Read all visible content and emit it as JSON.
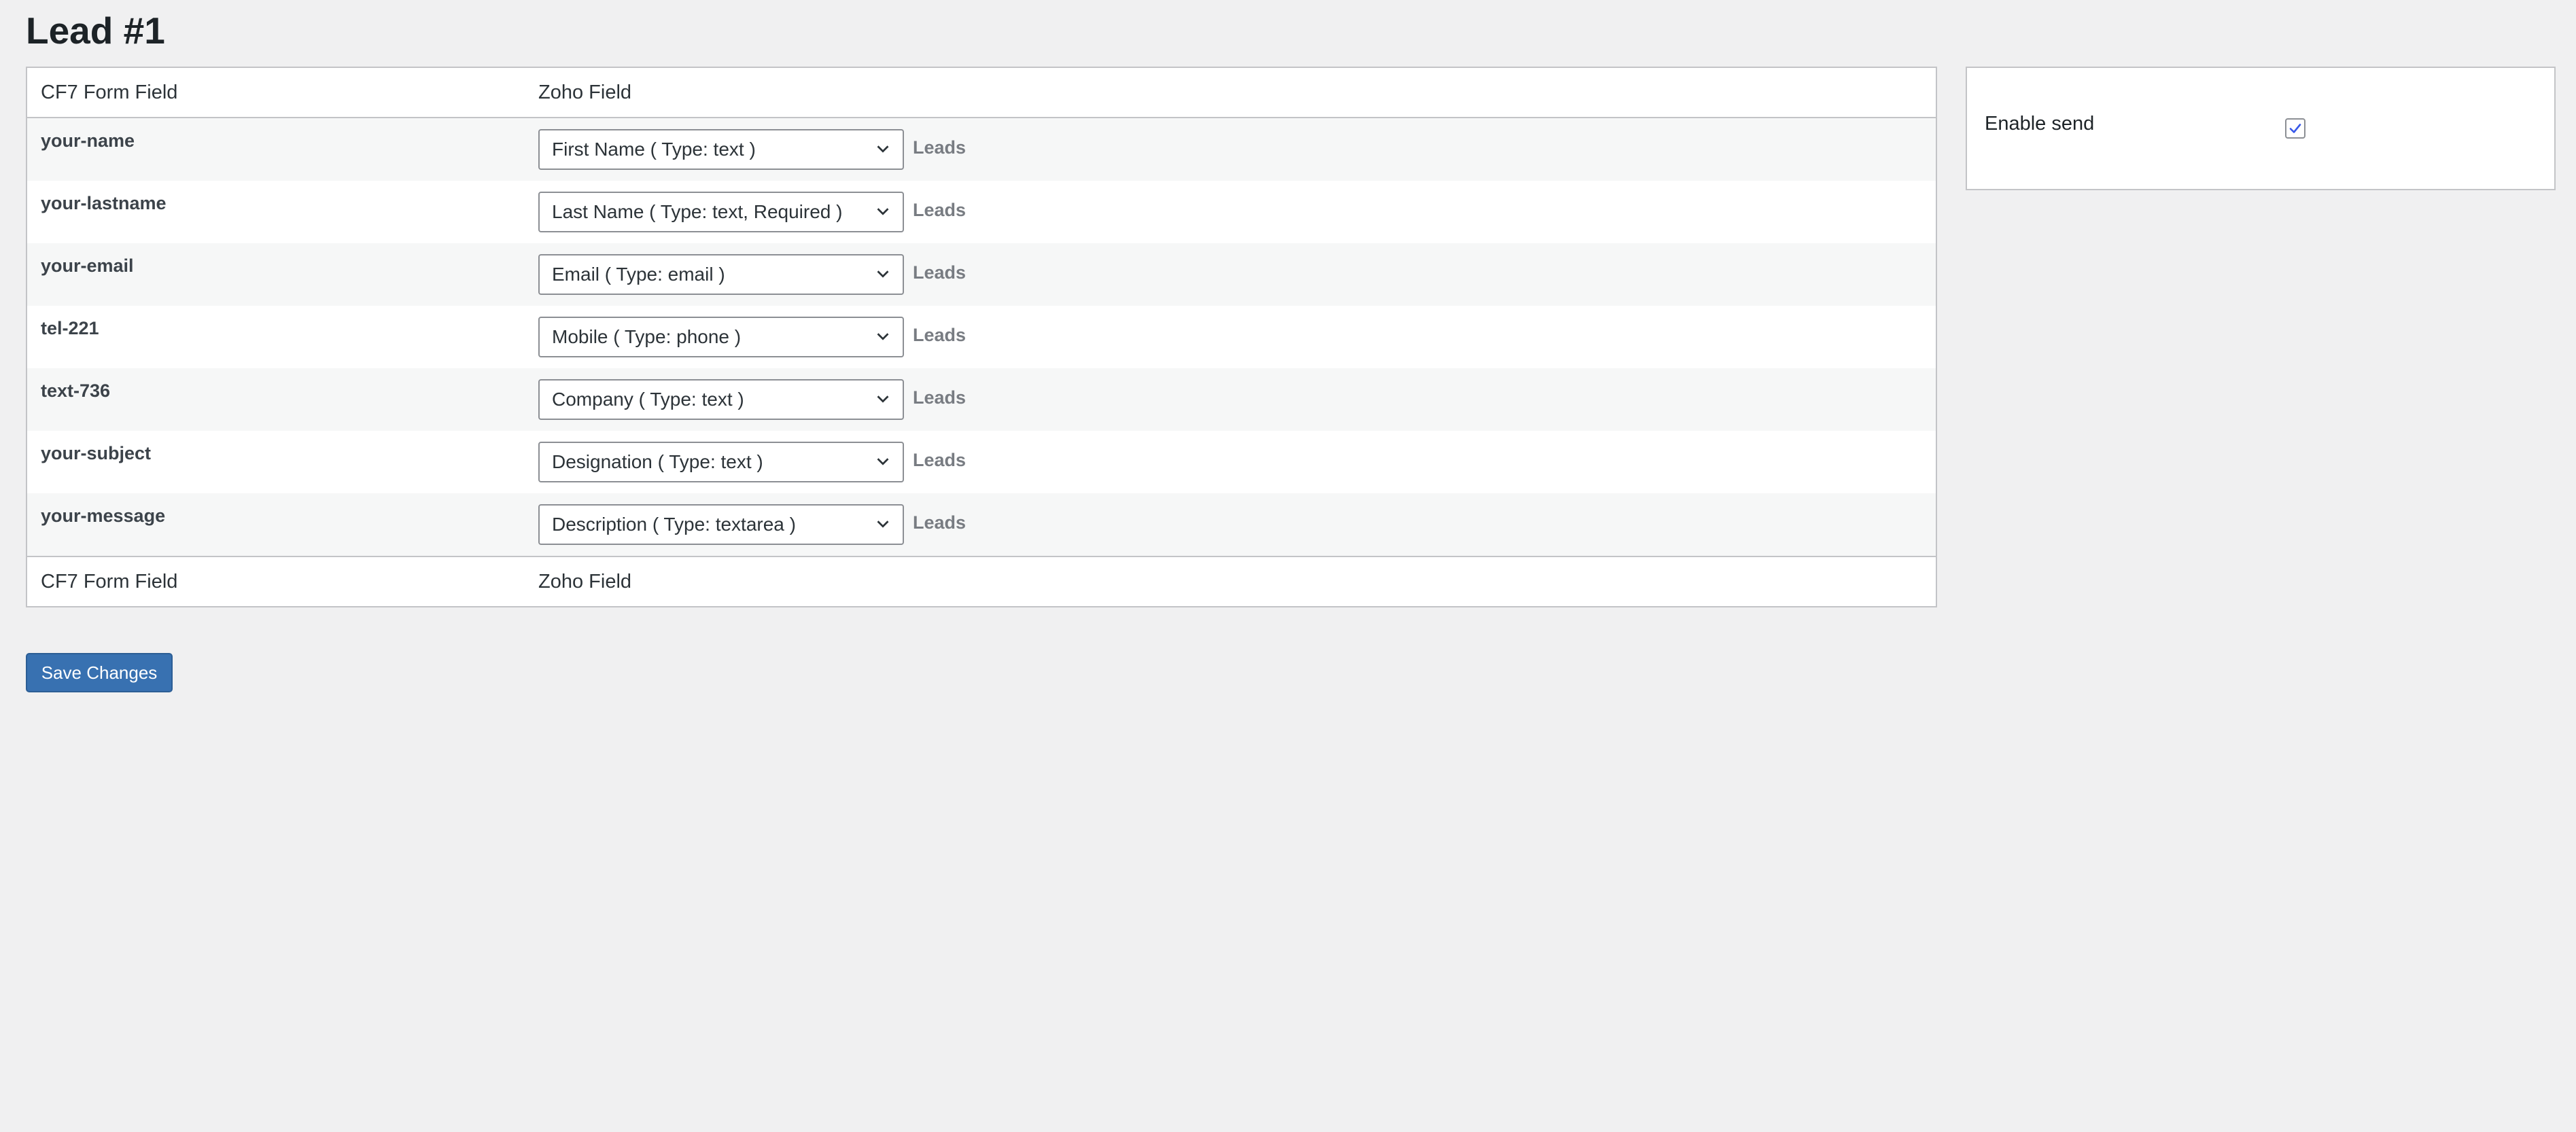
{
  "page": {
    "title": "Lead #1"
  },
  "table": {
    "header": {
      "cf7_label": "CF7 Form Field",
      "zoho_label": "Zoho Field"
    },
    "rows": [
      {
        "field": "your-name",
        "zoho_value": "First Name ( Type: text )",
        "module": "Leads"
      },
      {
        "field": "your-lastname",
        "zoho_value": "Last Name ( Type: text, Required )",
        "module": "Leads"
      },
      {
        "field": "your-email",
        "zoho_value": "Email ( Type: email )",
        "module": "Leads"
      },
      {
        "field": "tel-221",
        "zoho_value": "Mobile ( Type: phone )",
        "module": "Leads"
      },
      {
        "field": "text-736",
        "zoho_value": "Company ( Type: text )",
        "module": "Leads"
      },
      {
        "field": "your-subject",
        "zoho_value": "Designation ( Type: text )",
        "module": "Leads"
      },
      {
        "field": "your-message",
        "zoho_value": "Description ( Type: textarea )",
        "module": "Leads"
      }
    ],
    "footer": {
      "cf7_label": "CF7 Form Field",
      "zoho_label": "Zoho Field"
    }
  },
  "settings": {
    "enable_send_label": "Enable send",
    "enable_send_checked": true
  },
  "actions": {
    "save_label": "Save Changes"
  },
  "icons": {
    "select_arrow": "chevron-down-icon",
    "checkbox_mark": "checkmark-icon"
  },
  "colors": {
    "primary_button": "#3871b1",
    "checkmark": "#3858e9",
    "page_background": "#f0f0f1"
  }
}
